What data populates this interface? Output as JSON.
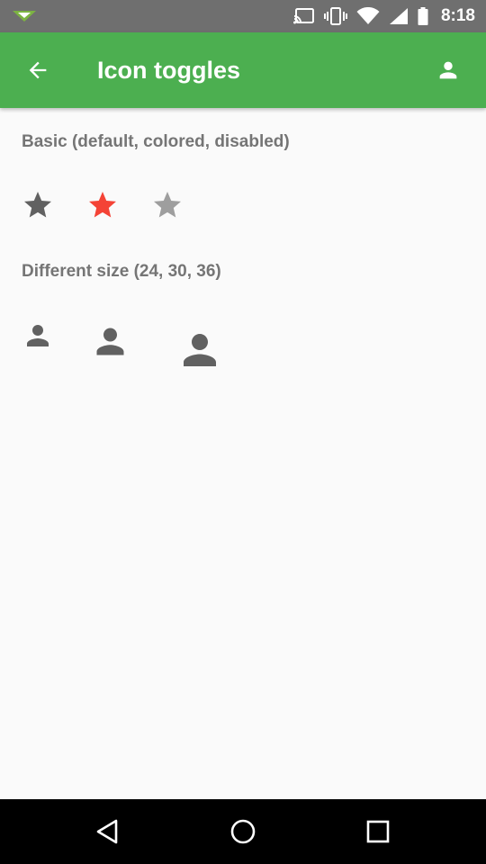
{
  "status_bar": {
    "time": "8:18",
    "icons": [
      "notification-icon",
      "cast-icon",
      "vibrate-icon",
      "wifi-icon",
      "signal-icon",
      "battery-icon"
    ]
  },
  "app_bar": {
    "title": "Icon toggles",
    "nav_icon": "arrow-back-icon",
    "action_icon": "account-icon",
    "color": "#4caf50"
  },
  "sections": {
    "basic": {
      "title": "Basic (default, colored, disabled)",
      "toggles": [
        {
          "icon": "star-icon",
          "state": "default",
          "color": "#616161"
        },
        {
          "icon": "star-icon",
          "state": "colored",
          "color": "#f44336"
        },
        {
          "icon": "star-icon",
          "state": "disabled",
          "color": "#9e9e9e"
        }
      ]
    },
    "size": {
      "title": "Different size (24, 30, 36)",
      "toggles": [
        {
          "icon": "person-icon",
          "size": 24,
          "color": "#616161"
        },
        {
          "icon": "person-icon",
          "size": 30,
          "color": "#616161"
        },
        {
          "icon": "person-icon",
          "size": 36,
          "color": "#616161"
        }
      ]
    }
  },
  "nav_bar": {
    "icons": [
      "back-triangle-icon",
      "home-circle-icon",
      "recents-square-icon"
    ]
  }
}
